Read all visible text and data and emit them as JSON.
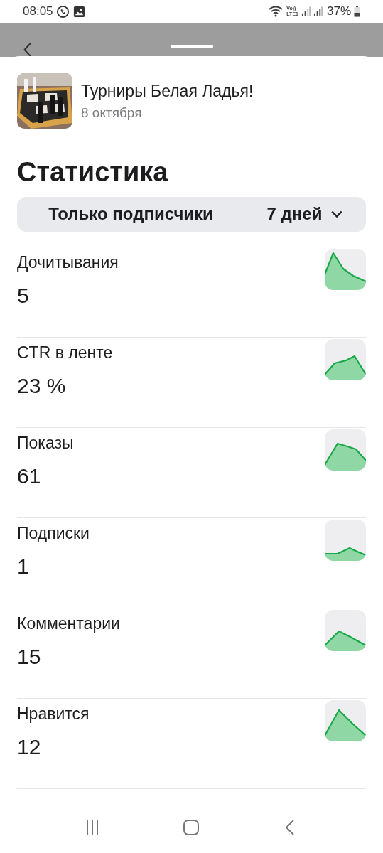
{
  "status_bar": {
    "time": "08:05",
    "network_top": "Vo))",
    "network_bottom": "LTE1",
    "battery": "37%"
  },
  "post": {
    "title": "Турниры Белая Ладья!",
    "date": "8 октября"
  },
  "heading": "Статистика",
  "filter": {
    "audience": "Только подписчики",
    "period": "7 дней"
  },
  "metrics": [
    {
      "label": "Дочитывания",
      "value": "5"
    },
    {
      "label": "CTR в ленте",
      "value": "23 %"
    },
    {
      "label": "Показы",
      "value": "61"
    },
    {
      "label": "Подписки",
      "value": "1"
    },
    {
      "label": "Комментарии",
      "value": "15"
    },
    {
      "label": "Нравится",
      "value": "12"
    }
  ]
}
